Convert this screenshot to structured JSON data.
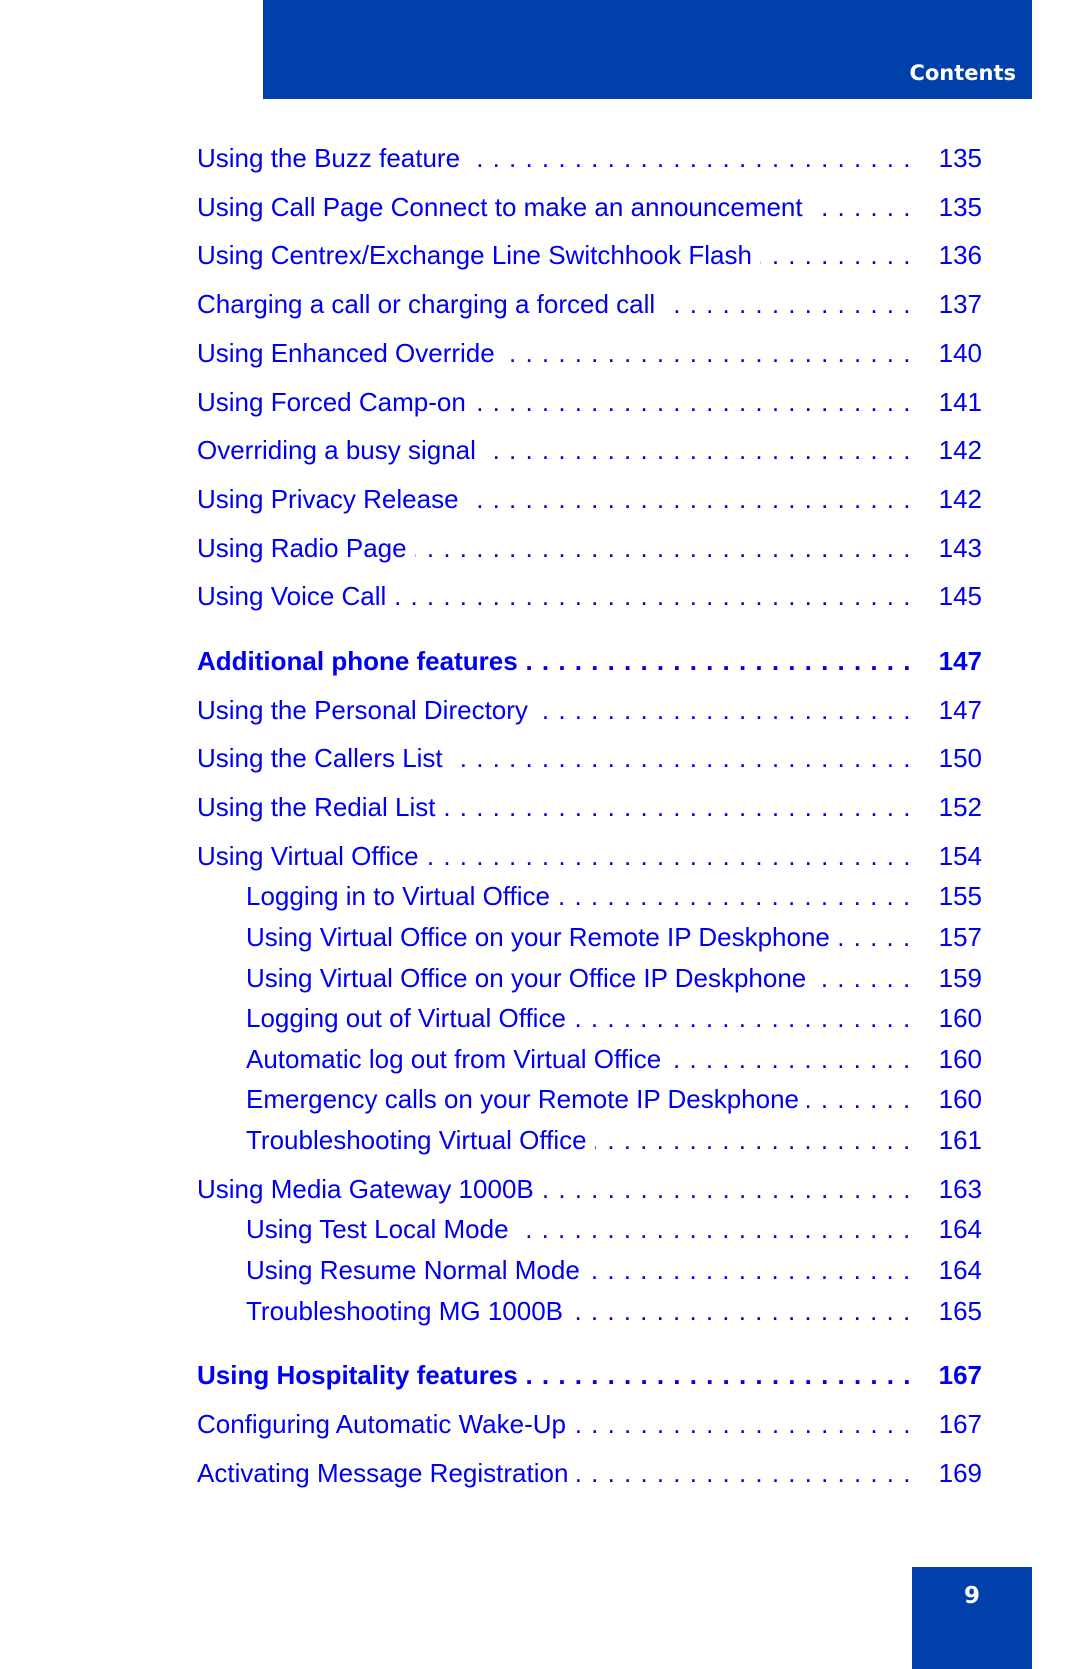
{
  "header": {
    "title": "Contents"
  },
  "toc": [
    {
      "label": "Using the Buzz feature",
      "page": "135",
      "level": 1,
      "bold": false
    },
    {
      "label": "Using Call Page Connect to make an announcement",
      "page": "135",
      "level": 1,
      "bold": false
    },
    {
      "label": "Using Centrex/Exchange Line Switchhook Flash",
      "page": "136",
      "level": 1,
      "bold": false
    },
    {
      "label": "Charging a call or charging a forced call",
      "page": "137",
      "level": 1,
      "bold": false
    },
    {
      "label": "Using Enhanced Override",
      "page": "140",
      "level": 1,
      "bold": false
    },
    {
      "label": "Using Forced Camp-on",
      "page": "141",
      "level": 1,
      "bold": false
    },
    {
      "label": "Overriding a busy signal",
      "page": "142",
      "level": 1,
      "bold": false
    },
    {
      "label": "Using Privacy Release",
      "page": "142",
      "level": 1,
      "bold": false
    },
    {
      "label": "Using Radio Page",
      "page": "143",
      "level": 1,
      "bold": false
    },
    {
      "label": "Using Voice Call",
      "page": "145",
      "level": 1,
      "bold": false
    },
    {
      "label": "Additional phone features",
      "page": "147",
      "level": 0,
      "bold": true
    },
    {
      "label": "Using the Personal Directory",
      "page": "147",
      "level": 1,
      "bold": false
    },
    {
      "label": "Using the Callers List",
      "page": "150",
      "level": 1,
      "bold": false
    },
    {
      "label": "Using the Redial List",
      "page": "152",
      "level": 1,
      "bold": false
    },
    {
      "label": "Using Virtual Office",
      "page": "154",
      "level": 1,
      "bold": false
    },
    {
      "label": "Logging in to Virtual Office",
      "page": "155",
      "level": 2,
      "bold": false
    },
    {
      "label": "Using Virtual Office on your Remote IP Deskphone",
      "page": "157",
      "level": 2,
      "bold": false
    },
    {
      "label": "Using Virtual Office on your Office IP Deskphone",
      "page": "159",
      "level": 2,
      "bold": false
    },
    {
      "label": "Logging out of Virtual Office",
      "page": "160",
      "level": 2,
      "bold": false
    },
    {
      "label": "Automatic log out from Virtual Office",
      "page": "160",
      "level": 2,
      "bold": false
    },
    {
      "label": "Emergency calls on your Remote IP Deskphone",
      "page": "160",
      "level": 2,
      "bold": false
    },
    {
      "label": "Troubleshooting Virtual Office",
      "page": "161",
      "level": 2,
      "bold": false
    },
    {
      "label": "Using Media Gateway 1000B",
      "page": "163",
      "level": 1,
      "bold": false
    },
    {
      "label": "Using Test Local Mode",
      "page": "164",
      "level": 2,
      "bold": false
    },
    {
      "label": "Using Resume Normal Mode",
      "page": "164",
      "level": 2,
      "bold": false
    },
    {
      "label": "Troubleshooting MG 1000B",
      "page": "165",
      "level": 2,
      "bold": false
    },
    {
      "label": "Using Hospitality features",
      "page": "167",
      "level": 0,
      "bold": true
    },
    {
      "label": "Configuring Automatic Wake-Up",
      "page": "167",
      "level": 1,
      "bold": false
    },
    {
      "label": "Activating Message Registration",
      "page": "169",
      "level": 1,
      "bold": false
    }
  ],
  "footer": {
    "page_number": "9"
  },
  "colors": {
    "brand_blue": "#0040ab",
    "link_blue": "#0000f0"
  }
}
